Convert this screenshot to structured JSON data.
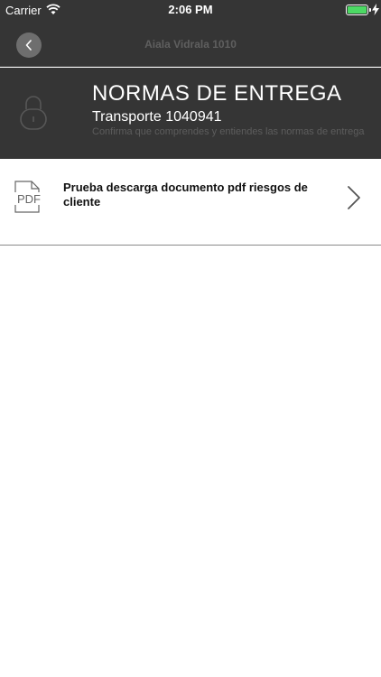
{
  "status_bar": {
    "carrier": "Carrier",
    "time": "2:06 PM",
    "battery_color": "#4cd964"
  },
  "nav": {
    "title": "Aiala Vidrala 1010",
    "back_icon": "chevron-left-icon"
  },
  "header": {
    "icon": "lock-icon",
    "title": "NORMAS DE ENTREGA",
    "subtitle": "Transporte 1040941",
    "description": "Confirma que comprendes y entiendes las normas de entrega"
  },
  "documents": [
    {
      "icon": "pdf-icon",
      "icon_text": "PDF",
      "label": "Prueba descarga documento pdf riesgos de cliente"
    }
  ],
  "colors": {
    "header_bg": "#353535",
    "text_dark": "#111111",
    "muted": "#5d5d5d"
  }
}
